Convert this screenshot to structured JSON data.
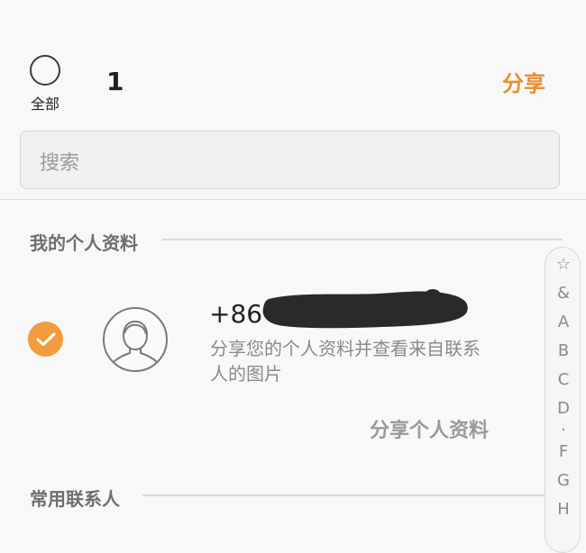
{
  "header": {
    "select_all_label": "全部",
    "selected_count": "1",
    "share_label": "分享"
  },
  "search": {
    "placeholder": "搜索"
  },
  "sections": {
    "my_profile": "我的个人资料",
    "favorites": "常用联系人"
  },
  "profile": {
    "phone_prefix": "+86",
    "description": "分享您的个人资料并查看来自联系人的图片",
    "share_button": "分享个人资料",
    "selected": true
  },
  "index_bar": {
    "items": [
      "☆",
      "&",
      "A",
      "B",
      "C",
      "D",
      "·",
      "F",
      "G",
      "H"
    ]
  },
  "colors": {
    "accent": "#e88f2c",
    "check": "#f29c3f",
    "muted_text": "#8a8a8a"
  }
}
